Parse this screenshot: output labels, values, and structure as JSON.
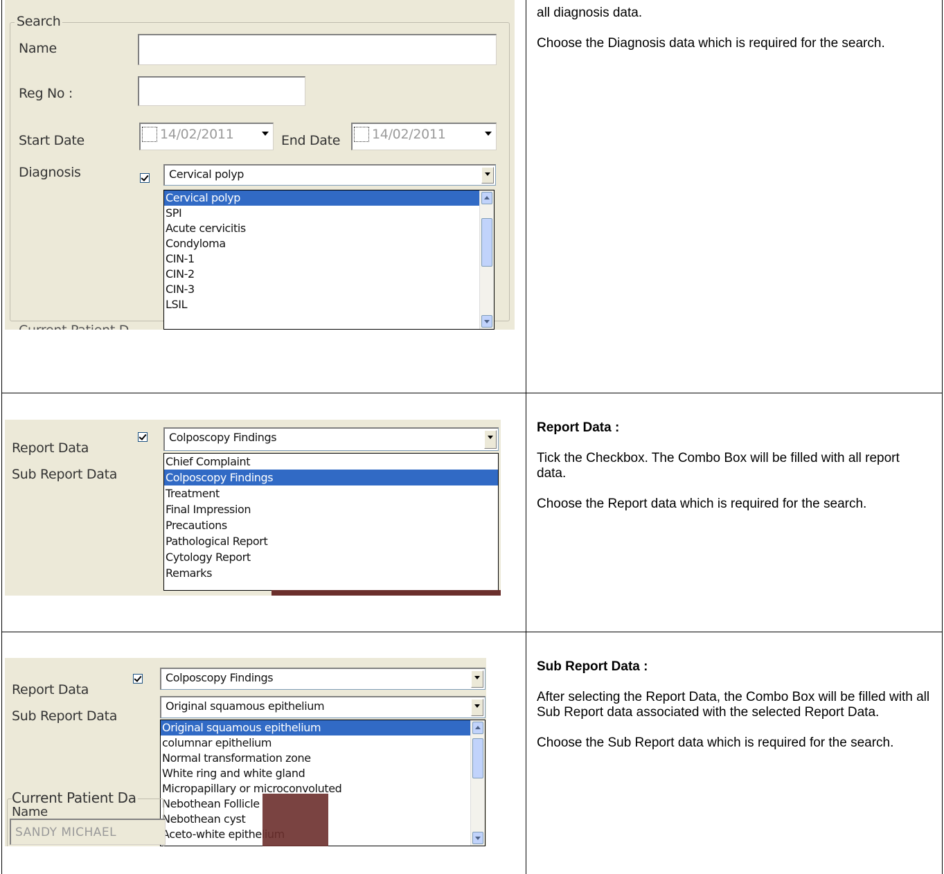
{
  "row1": {
    "description": {
      "line1": "all diagnosis data.",
      "line2": "Choose the Diagnosis data which is required for the search."
    },
    "screenshot": {
      "group_title": "Search",
      "name_label": "Name",
      "name_value": "",
      "regno_label": "Reg No :",
      "regno_value": "",
      "start_date_label": "Start Date",
      "start_date_value": "14/02/2011",
      "end_date_label": "End Date",
      "end_date_value": "14/02/2011",
      "diagnosis_label": "Diagnosis",
      "diagnosis_checked": true,
      "diagnosis_selected": "Cervical polyp",
      "diagnosis_options": [
        "Cervical polyp",
        "SPI",
        "Acute cervicitis",
        "Condyloma",
        "CIN-1",
        "CIN-2",
        "CIN-3",
        "LSIL"
      ],
      "cut_label": "Current Patient D"
    }
  },
  "row2": {
    "description": {
      "heading": "Report Data :",
      "para1": "Tick the Checkbox. The Combo Box will be filled with all report data.",
      "para2": "Choose the Report data which is required for the search."
    },
    "screenshot": {
      "report_label": "Report Data",
      "report_checked": true,
      "report_selected": "Colposcopy Findings",
      "subreport_label": "Sub Report Data",
      "report_options": [
        "Chief Complaint",
        "Colposcopy Findings",
        "Treatment",
        "Final Impression",
        "Precautions",
        "Pathological Report",
        "Cytology Report",
        "Remarks"
      ],
      "report_options_selected_index": 1
    }
  },
  "row3": {
    "description": {
      "heading": "Sub Report Data :",
      "para1": "After selecting the Report Data, the Combo Box will be filled with all Sub Report data associated with the selected Report Data.",
      "para2": "Choose the Sub Report data which is required for the search."
    },
    "screenshot": {
      "report_label": "Report Data",
      "report_checked": true,
      "report_selected": "Colposcopy Findings",
      "subreport_label": "Sub Report Data",
      "subreport_selected": "Original squamous epithelium",
      "subreport_options": [
        "Original squamous epithelium",
        "columnar epithelium",
        "Normal transformation zone",
        "White ring and white gland",
        "Micropapillary or microconvoluted",
        "Nebothean Follicle",
        "Nebothean cyst",
        "Aceto-white epithelium"
      ],
      "current_patient_label": "Current Patient Da",
      "name_label": "Name",
      "name_value": "SANDY MICHAEL"
    }
  }
}
